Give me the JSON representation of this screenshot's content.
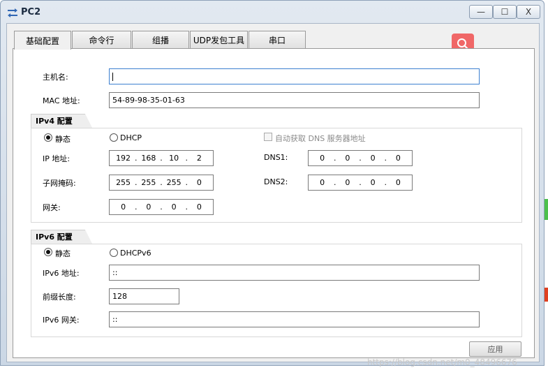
{
  "window": {
    "title": "PC2",
    "minimize_glyph": "—",
    "maximize_glyph": "☐",
    "close_glyph": "X"
  },
  "tabs": [
    {
      "label": "基础配置",
      "active": true
    },
    {
      "label": "命令行",
      "active": false
    },
    {
      "label": "组播",
      "active": false
    },
    {
      "label": "UDP发包工具",
      "active": false
    },
    {
      "label": "串口",
      "active": false
    }
  ],
  "basic": {
    "hostname_label": "主机名:",
    "hostname_value": "",
    "mac_label": "MAC 地址:",
    "mac_value": "54-89-98-35-01-63"
  },
  "ipv4": {
    "group_title": "IPv4 配置",
    "static_label": "静态",
    "dhcp_label": "DHCP",
    "auto_dns_label": "自动获取 DNS 服务器地址",
    "ip_label": "IP 地址:",
    "ip": [
      "192",
      "168",
      "10",
      "2"
    ],
    "mask_label": "子网掩码:",
    "mask": [
      "255",
      "255",
      "255",
      "0"
    ],
    "gateway_label": "网关:",
    "gateway": [
      "0",
      "0",
      "0",
      "0"
    ],
    "dns1_label": "DNS1:",
    "dns1": [
      "0",
      "0",
      "0",
      "0"
    ],
    "dns2_label": "DNS2:",
    "dns2": [
      "0",
      "0",
      "0",
      "0"
    ]
  },
  "ipv6": {
    "group_title": "IPv6 配置",
    "static_label": "静态",
    "dhcpv6_label": "DHCPv6",
    "ip_label": "IPv6 地址:",
    "ip_value": "::",
    "prefix_label": "前缀长度:",
    "prefix_value": "128",
    "gateway_label": "IPv6 网关:",
    "gateway_value": "::"
  },
  "apply_label": "应用",
  "watermark": "https://blog.csdn.net/m0_48496676",
  "colors": {
    "search_button": "#f06767",
    "title_bg": "#d5dfeb",
    "client_bg": "#f0f0f0"
  },
  "icons": {
    "app": "network-device-icon",
    "search": "search-icon"
  }
}
